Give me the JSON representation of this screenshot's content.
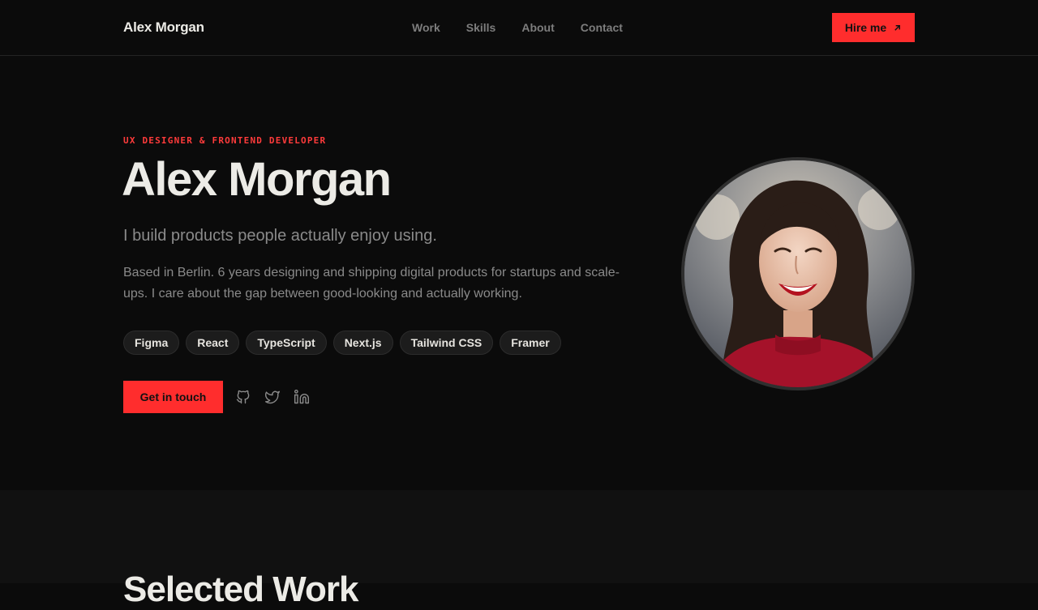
{
  "nav": {
    "brand": "Alex Morgan",
    "links": [
      "Work",
      "Skills",
      "About",
      "Contact"
    ],
    "hire_label": "Hire me"
  },
  "hero": {
    "eyebrow": "UX DESIGNER & FRONTEND DEVELOPER",
    "title": "Alex Morgan",
    "tagline": "I build products people actually enjoy using.",
    "bio": "Based in Berlin. 6 years designing and shipping digital products for startups and scale-ups. I care about the gap between good-looking and actually working.",
    "skills": [
      "Figma",
      "React",
      "TypeScript",
      "Next.js",
      "Tailwind CSS",
      "Framer"
    ],
    "cta_label": "Get in touch",
    "socials": [
      "github-icon",
      "twitter-icon",
      "linkedin-icon"
    ]
  },
  "work": {
    "title": "Selected Work"
  },
  "colors": {
    "accent": "#ff2d2d",
    "background": "#0b0b0b",
    "text": "#ecebe6",
    "muted": "#8a8a8a"
  }
}
